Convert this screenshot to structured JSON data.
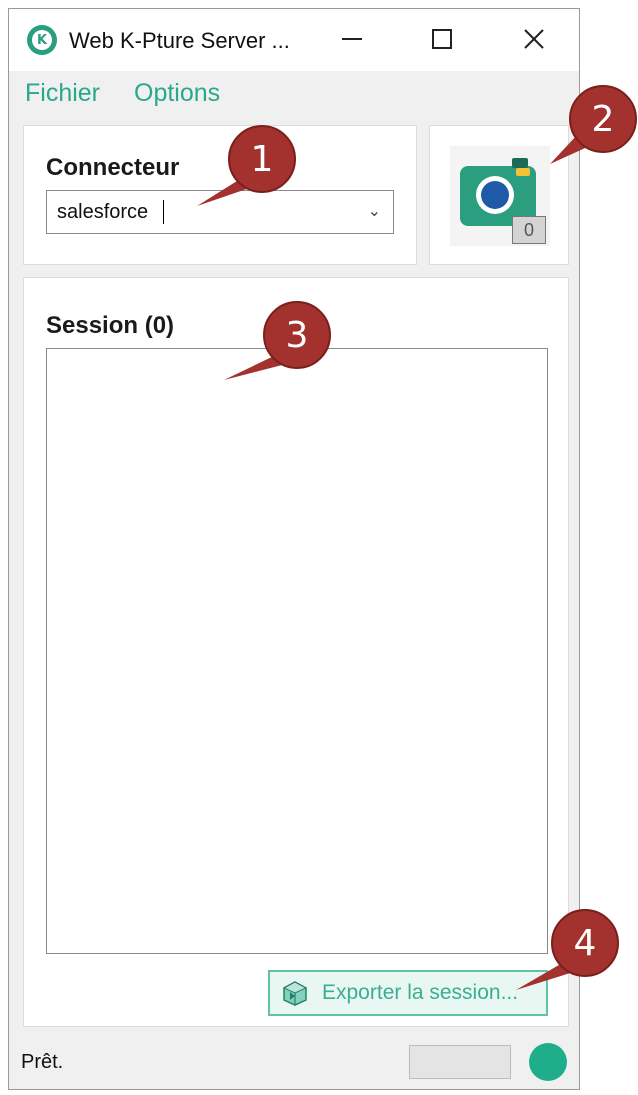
{
  "window": {
    "title": "Web K-Pture Server ...",
    "app_icon_letter": "K",
    "controls": {
      "minimize": "minimize-icon",
      "maximize": "maximize-icon",
      "close": "close-icon"
    }
  },
  "menu": {
    "items": [
      "Fichier",
      "Options"
    ]
  },
  "connecteur": {
    "label": "Connecteur",
    "selected_value": "salesforce"
  },
  "camera": {
    "icon": "camera-icon",
    "count": "0"
  },
  "session": {
    "label": "Session (0)",
    "items": [],
    "export_button_label": "Exporter la session..."
  },
  "status": {
    "text": "Prêt."
  },
  "callouts": [
    "1",
    "2",
    "3",
    "4"
  ],
  "colors": {
    "accent": "#2aa88a",
    "callout": "#a3312e",
    "status_led": "#1fae8a",
    "camera_body": "#2b9e80",
    "camera_lens": "#1e5aa8"
  }
}
